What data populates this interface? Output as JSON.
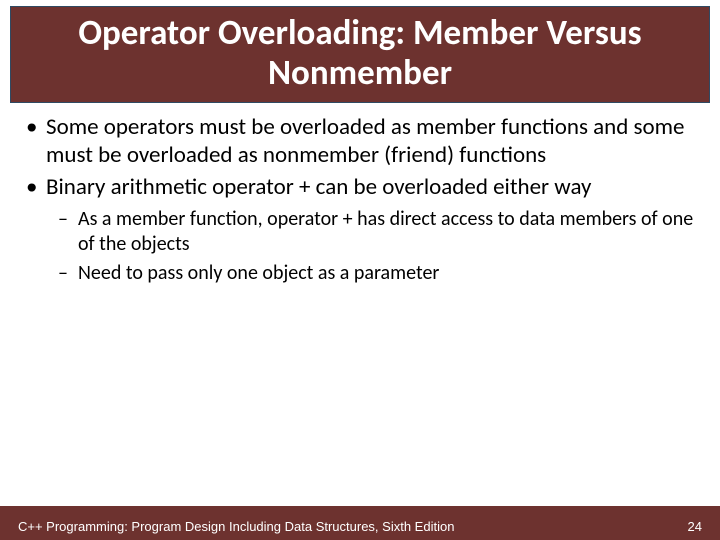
{
  "title": "Operator Overloading: Member Versus Nonmember",
  "bullets": [
    {
      "text": "Some operators must be overloaded as member functions and some must be overloaded as nonmember (friend) functions"
    },
    {
      "text": "Binary arithmetic operator + can be overloaded either way",
      "sub": [
        "As a member function, operator + has direct access to data members of one of the objects",
        "Need to pass only one object as a parameter"
      ]
    }
  ],
  "footer": {
    "source": "C++ Programming: Program Design Including Data Structures, Sixth Edition",
    "page": "24"
  }
}
